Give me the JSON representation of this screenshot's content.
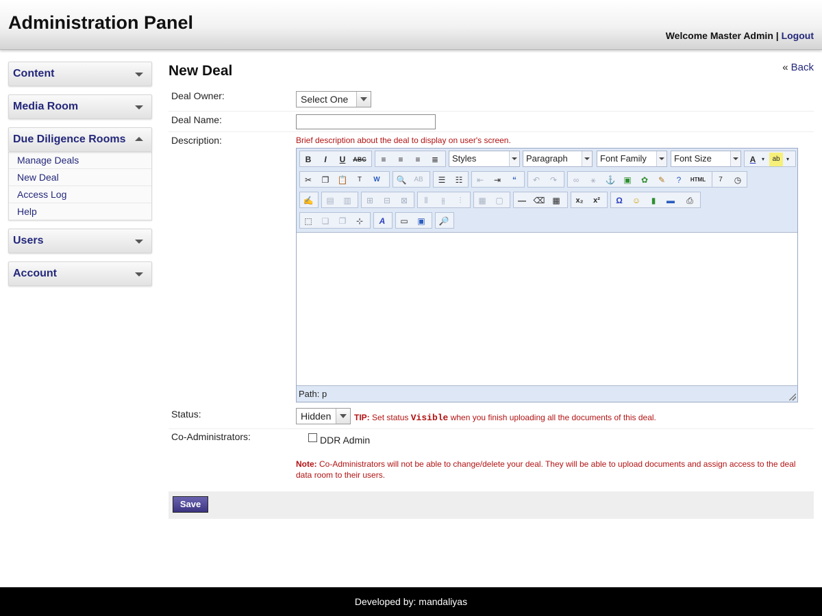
{
  "header": {
    "title": "Administration Panel",
    "welcome": "Welcome Master Admin",
    "separator": "|",
    "logout": "Logout"
  },
  "sidebar": {
    "sections": [
      {
        "label": "Content"
      },
      {
        "label": "Media Room"
      },
      {
        "label": "Due Diligence Rooms",
        "items": [
          "Manage Deals",
          "New Deal",
          "Access Log",
          "Help"
        ]
      },
      {
        "label": "Users"
      },
      {
        "label": "Account"
      }
    ]
  },
  "main": {
    "title": "New Deal",
    "back": "Back",
    "form": {
      "owner_label": "Deal Owner:",
      "owner_value": "Select One",
      "name_label": "Deal Name:",
      "name_value": "",
      "description_label": "Description:",
      "description_hint": "Brief description about the deal to display on user's screen.",
      "editor": {
        "styles": "Styles",
        "paragraph": "Paragraph",
        "font_family": "Font Family",
        "font_size": "Font Size",
        "path": "Path: p"
      },
      "status_label": "Status:",
      "status_value": "Hidden",
      "tip_label": "TIP:",
      "tip_text_1": "Set status",
      "tip_code": "Visible",
      "tip_text_2": "when you finish uploading all the documents of this deal.",
      "coadmin_label": "Co-Administrators:",
      "coadmin_option": "DDR Admin",
      "note_label": "Note:",
      "note_text": "Co-Administrators will not be able to change/delete your deal. They will be able to upload documents and assign access to the deal data room to their users.",
      "save": "Save"
    }
  },
  "footer": {
    "text": "Developed by: mandaliyas"
  },
  "colors": {
    "link": "#23277a",
    "warning": "#b21212",
    "toolbar": "#dee7f5",
    "save": "#4a4394"
  }
}
